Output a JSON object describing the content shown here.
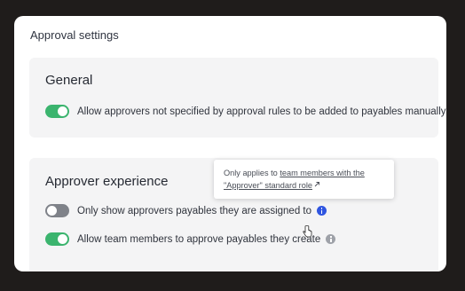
{
  "page": {
    "title": "Approval settings"
  },
  "general": {
    "title": "General",
    "settings": [
      {
        "label": "Allow approvers not specified by approval rules to be added to payables manually",
        "enabled": true
      }
    ]
  },
  "approver_experience": {
    "title": "Approver experience",
    "settings": [
      {
        "label": "Only show approvers payables they are assigned to",
        "enabled": false
      },
      {
        "label": "Allow team members to approve payables they create",
        "enabled": true
      }
    ]
  },
  "tooltip": {
    "prefix": "Only applies to ",
    "link_text_line1": "team members with the",
    "link_text_line2": "\"Approver\" standard role"
  },
  "colors": {
    "toggle_on": "#3bb46e",
    "toggle_off": "#7f8289",
    "info_active": "#2f55e0",
    "card_background": "#f4f4f5"
  },
  "icons": {
    "info": "info-icon",
    "external_link": "external-link-icon",
    "cursor": "pointer-cursor-icon"
  }
}
